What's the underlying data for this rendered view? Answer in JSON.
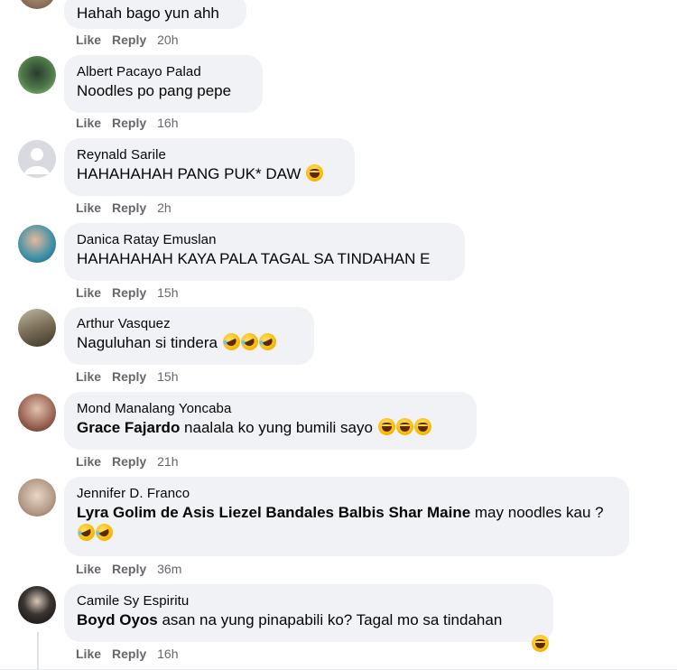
{
  "actions": {
    "like": "Like",
    "reply": "Reply"
  },
  "comments": [
    {
      "name": "",
      "parts": [
        {
          "t": "Hahah bago yun ahh"
        }
      ],
      "time": "20h"
    },
    {
      "name": "Albert Pacayo Palad",
      "parts": [
        {
          "t": "Noodles po pang pepe"
        }
      ],
      "time": "16h"
    },
    {
      "name": "Reynald Sarile",
      "parts": [
        {
          "t": "HAHAHAHAH PANG PUK* DAW "
        }
      ],
      "emoji": [
        "laugh"
      ],
      "time": "2h"
    },
    {
      "name": "Danica Ratay Emuslan",
      "parts": [
        {
          "t": "HAHAHAHAH KAYA PALA TAGAL SA TINDAHAN E"
        }
      ],
      "time": "15h"
    },
    {
      "name": "Arthur Vasquez",
      "parts": [
        {
          "t": "Naguluhan si tindera "
        }
      ],
      "emoji": [
        "rofl",
        "rofl",
        "rofl"
      ],
      "time": "15h"
    },
    {
      "name": "Mond Manalang Yoncaba",
      "parts": [
        {
          "m": "Grace Fajardo"
        },
        {
          "t": " naalala ko yung bumili sayo "
        }
      ],
      "emoji": [
        "laugh",
        "laugh",
        "laugh"
      ],
      "time": "21h"
    },
    {
      "name": "Jennifer D. Franco",
      "parts": [
        {
          "m": "Lyra Golim de Asis Liezel Bandales Balbis Shar Maine"
        },
        {
          "t": " may noodles kau ? "
        }
      ],
      "emoji": [
        "rofl",
        "rofl"
      ],
      "time": "36m"
    },
    {
      "name": "Camile Sy Espiritu",
      "parts": [
        {
          "m": "Boyd Oyos"
        },
        {
          "t": " asan na yung pinapabili ko? Tagal mo sa tindahan"
        }
      ],
      "emoji": [
        "laugh"
      ],
      "time": "16h"
    }
  ]
}
